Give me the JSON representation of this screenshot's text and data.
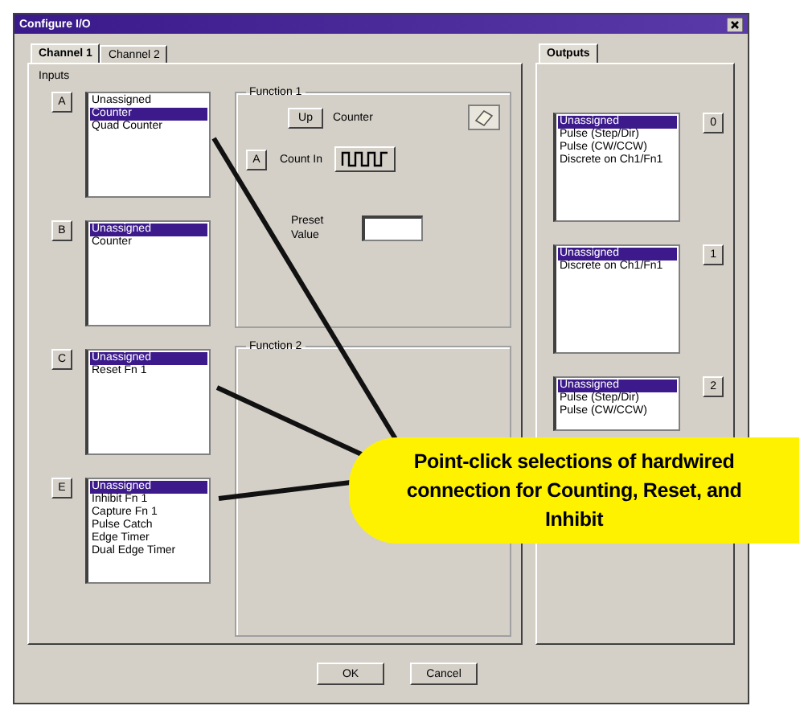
{
  "window": {
    "title": "Configure I/O"
  },
  "tabs": [
    {
      "label": "Channel 1",
      "selected": true
    },
    {
      "label": "Channel 2",
      "selected": false
    }
  ],
  "inputs": {
    "label": "Inputs",
    "groups": [
      {
        "button": "A",
        "items": [
          {
            "text": "Unassigned",
            "selected": false
          },
          {
            "text": "Counter",
            "selected": true
          },
          {
            "text": "Quad Counter",
            "selected": false
          }
        ]
      },
      {
        "button": "B",
        "items": [
          {
            "text": "Unassigned",
            "selected": true
          },
          {
            "text": "Counter",
            "selected": false
          }
        ]
      },
      {
        "button": "C",
        "items": [
          {
            "text": "Unassigned",
            "selected": true
          },
          {
            "text": "Reset Fn 1",
            "selected": false
          }
        ]
      },
      {
        "button": "E",
        "items": [
          {
            "text": "Unassigned",
            "selected": true
          },
          {
            "text": "Inhibit Fn 1",
            "selected": false
          },
          {
            "text": "Capture Fn 1",
            "selected": false
          },
          {
            "text": "Pulse Catch",
            "selected": false
          },
          {
            "text": "Edge Timer",
            "selected": false
          },
          {
            "text": "Dual Edge Timer",
            "selected": false
          }
        ]
      }
    ]
  },
  "function_1": {
    "title": "Function 1",
    "mode_button": "Up",
    "mode_label": "Counter",
    "count_in_button": "A",
    "count_in_label": "Count In",
    "preset_label": "Preset Value"
  },
  "function_2": {
    "title": "Function 2"
  },
  "outputs": {
    "tab": "Outputs",
    "groups": [
      {
        "button": "0",
        "items": [
          {
            "text": "Unassigned",
            "selected": true
          },
          {
            "text": "Pulse (Step/Dir)",
            "selected": false
          },
          {
            "text": "Pulse (CW/CCW)",
            "selected": false
          },
          {
            "text": "Discrete on Ch1/Fn1",
            "selected": false
          }
        ]
      },
      {
        "button": "1",
        "items": [
          {
            "text": "Unassigned",
            "selected": true
          },
          {
            "text": "Discrete on Ch1/Fn1",
            "selected": false
          }
        ]
      },
      {
        "button": "2",
        "items": [
          {
            "text": "Unassigned",
            "selected": true
          },
          {
            "text": "Pulse (Step/Dir)",
            "selected": false
          },
          {
            "text": "Pulse (CW/CCW)",
            "selected": false
          }
        ]
      }
    ]
  },
  "buttons": [
    "OK",
    "Cancel"
  ],
  "callout": {
    "text": "Point-click selections of hardwired connection for Counting, Reset, and Inhibit"
  }
}
